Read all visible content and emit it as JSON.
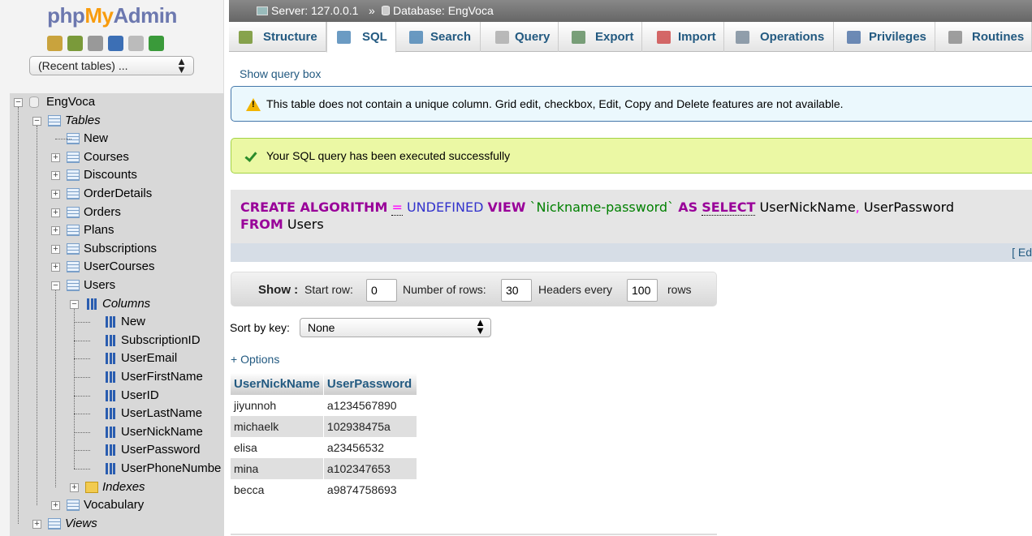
{
  "logo": {
    "php": "php",
    "my": "My",
    "admin": "Admin"
  },
  "quick_icons": [
    {
      "name": "home-icon",
      "color": "#c9a33d"
    },
    {
      "name": "exit-icon",
      "color": "#7a9a3a"
    },
    {
      "name": "query-window-icon",
      "color": "#999999"
    },
    {
      "name": "help-icon",
      "color": "#3c6fb5"
    },
    {
      "name": "docs-icon",
      "color": "#bbbbbb"
    },
    {
      "name": "reload-icon",
      "color": "#3a9a3a"
    }
  ],
  "recent_tables": "(Recent tables) ...",
  "tree": {
    "db": "EngVoca",
    "tables_label": "Tables",
    "new_label": "New",
    "tables": [
      "Courses",
      "Discounts",
      "OrderDetails",
      "Orders",
      "Plans",
      "Subscriptions",
      "UserCourses",
      "Users"
    ],
    "columns_label": "Columns",
    "columns_new": "New",
    "columns": [
      "SubscriptionID",
      "UserEmail",
      "UserFirstName",
      "UserID",
      "UserLastName",
      "UserNickName",
      "UserPassword",
      "UserPhoneNumbe"
    ],
    "indexes_label": "Indexes",
    "vocabulary": "Vocabulary",
    "views_label": "Views"
  },
  "breadcrumb": {
    "server": "Server: 127.0.0.1",
    "sep": "»",
    "database": "Database: EngVoca"
  },
  "tabs": [
    "Structure",
    "SQL",
    "Search",
    "Query",
    "Export",
    "Import",
    "Operations",
    "Privileges",
    "Routines"
  ],
  "show_query_box": "Show query box",
  "notice": "This table does not contain a unique column. Grid edit, checkbox, Edit, Copy and Delete features are not available.",
  "success": "Your SQL query has been executed successfully",
  "sql": {
    "create_algorithm": "CREATE ALGORITHM",
    "eq": "=",
    "undefined": "UNDEFINED",
    "view": "VIEW",
    "name": "`Nickname-password`",
    "as": "AS",
    "select": "SELECT",
    "col1": "UserNickName",
    "comma": ",",
    "col2": "UserPassword",
    "from": "FROM",
    "table": "Users"
  },
  "edit_link": "[ Ed",
  "showbar": {
    "show": "Show :",
    "start_row": "Start row:",
    "start_val": "0",
    "num_rows": "Number of rows:",
    "num_val": "30",
    "headers_every": "Headers every",
    "headers_val": "100",
    "rows": "rows"
  },
  "sort": {
    "label": "Sort by key:",
    "value": "None"
  },
  "options_link": "+ Options",
  "results": {
    "headers": [
      "UserNickName",
      "UserPassword"
    ],
    "rows": [
      [
        "jiyunnoh",
        "a1234567890"
      ],
      [
        "michaelk",
        "102938475a"
      ],
      [
        "elisa",
        "a23456532"
      ],
      [
        "mina",
        "a102347653"
      ],
      [
        "becca",
        "a9874758693"
      ]
    ]
  },
  "tab_icon_colors": [
    "#6b8e23",
    "#4682b4",
    "#4682b4",
    "#aaaaaa",
    "#5a8a5a",
    "#c44",
    "#778899",
    "#4a6fa5",
    "#888888"
  ]
}
